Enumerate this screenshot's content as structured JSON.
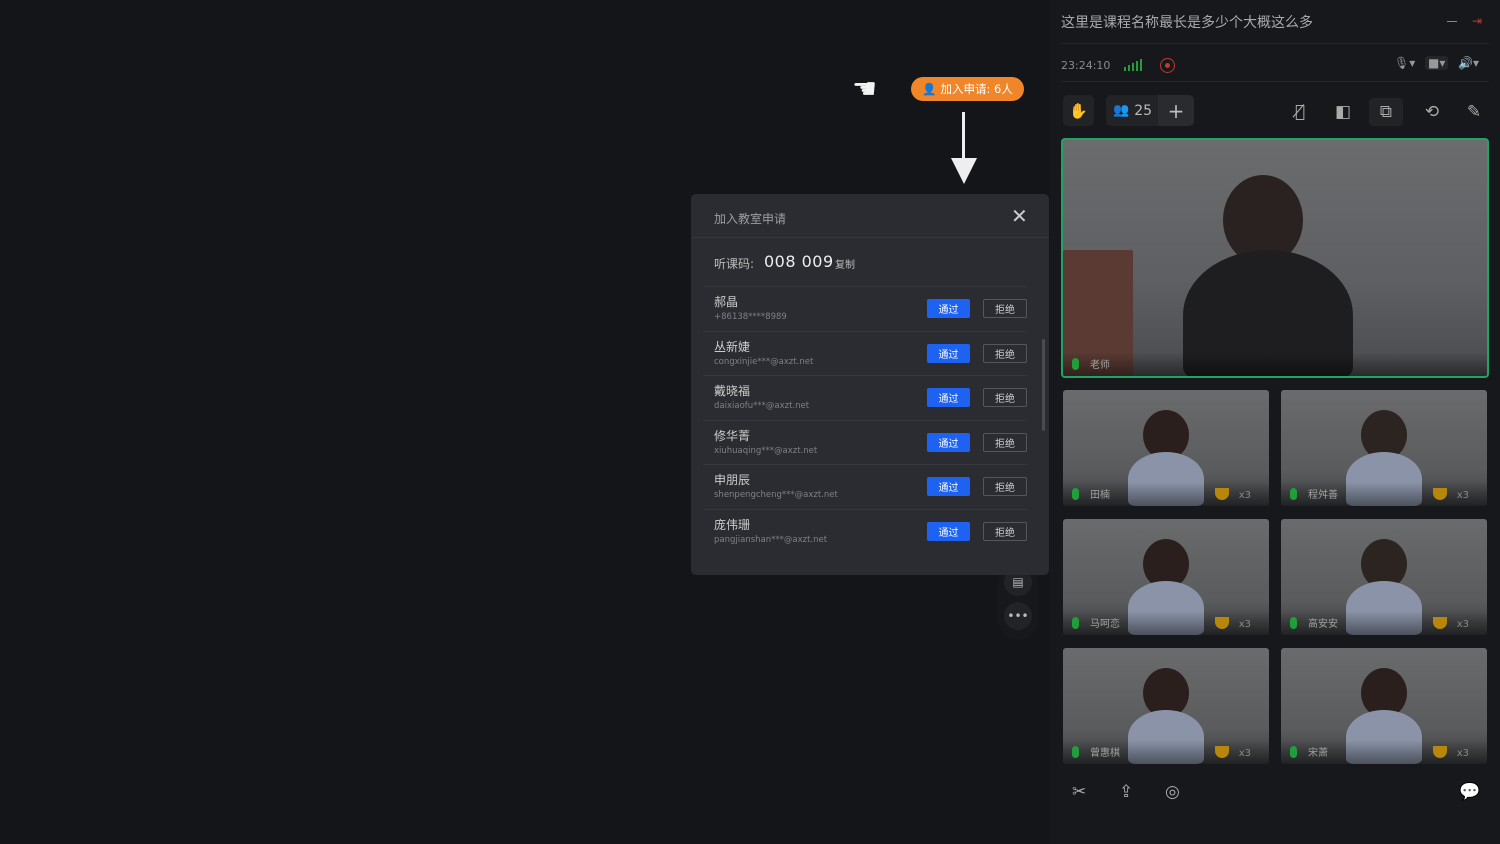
{
  "header": {
    "title": "这里是课程名称最长是多少个大概这么多",
    "time": "23:24:10"
  },
  "toolbar": {
    "participants": "25",
    "plus": "+"
  },
  "teacher": {
    "name": "老师"
  },
  "students": [
    {
      "name": "田楠",
      "count": "x3"
    },
    {
      "name": "程舛善",
      "count": "x3"
    },
    {
      "name": "马呵恋",
      "count": "x3"
    },
    {
      "name": "高安安",
      "count": "x3"
    },
    {
      "name": "曾惠棋",
      "count": "x3"
    },
    {
      "name": "宋萧",
      "count": "x3"
    }
  ],
  "badge": {
    "label": "加入申请: 6人"
  },
  "dialog": {
    "title": "加入教室申请",
    "code_label": "听课码:",
    "code": "008 009",
    "copy": "复制",
    "approve": "通过",
    "reject": "拒绝",
    "requests": [
      {
        "name": "郝晶",
        "contact": "+86138****8989"
      },
      {
        "name": "丛新婕",
        "contact": "congxinjie***@axzt.net"
      },
      {
        "name": "戴晓福",
        "contact": "daixiaofu***@axzt.net"
      },
      {
        "name": "修华菁",
        "contact": "xiuhuaqing***@axzt.net"
      },
      {
        "name": "申朋辰",
        "contact": "shenpengcheng***@axzt.net"
      },
      {
        "name": "庞伟珊",
        "contact": "pangjianshan***@axzt.net"
      }
    ]
  },
  "colors": {
    "accent": "#1d62f0",
    "badge": "#f0862a",
    "active_border": "#1fa463",
    "mic": "#1f9e3a"
  }
}
